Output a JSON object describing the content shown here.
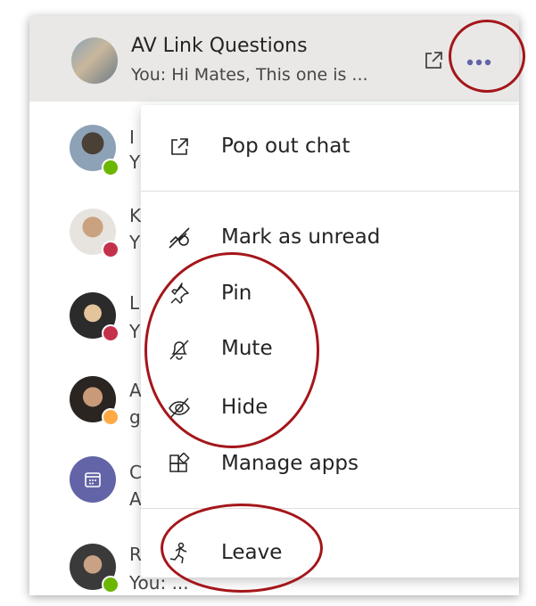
{
  "chat": {
    "title": "AV Link Questions",
    "preview": "You: Hi Mates, This one is ..."
  },
  "list_rows": [
    {
      "initial": "I",
      "sub": "Y",
      "status": "available"
    },
    {
      "initial": "K",
      "sub": "Y",
      "status": "busy"
    },
    {
      "initial": "L",
      "sub": "Y",
      "status": "busy"
    },
    {
      "initial": "A",
      "sub": "g",
      "status": "away"
    },
    {
      "initial": "C",
      "sub": "A",
      "status": "none"
    },
    {
      "initial": "R",
      "sub": "You: ...",
      "status": "available"
    }
  ],
  "menu": {
    "items": [
      {
        "label": "Pop out chat",
        "icon": "pop-out-icon"
      },
      {
        "label": "Mark as unread",
        "icon": "mark-unread-icon"
      },
      {
        "label": "Pin",
        "icon": "pin-icon"
      },
      {
        "label": "Mute",
        "icon": "mute-bell-icon"
      },
      {
        "label": "Hide",
        "icon": "hide-eye-icon"
      },
      {
        "label": "Manage apps",
        "icon": "manage-apps-icon"
      },
      {
        "label": "Leave",
        "icon": "leave-icon"
      }
    ]
  },
  "colors": {
    "accent": "#6264a7",
    "available": "#6bb700",
    "busy": "#c4314b",
    "away": "#ffaa44",
    "annotation": "#a4161a"
  }
}
